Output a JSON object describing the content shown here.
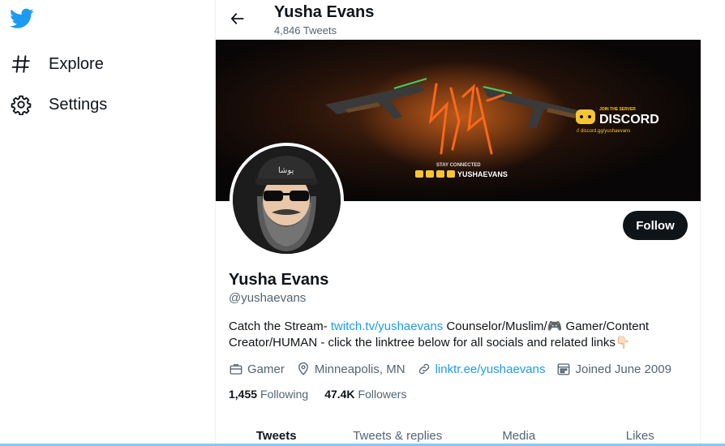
{
  "nav": {
    "items": [
      {
        "label": "Explore",
        "icon": "hashtag-icon"
      },
      {
        "label": "Settings",
        "icon": "gear-icon"
      }
    ]
  },
  "header": {
    "title": "Yusha Evans",
    "tweet_count": "4,846 Tweets"
  },
  "banner": {
    "artwork_text": "YUSHA",
    "discord_join": "JOIN THE SERVER",
    "discord_name": "DISCORD",
    "discord_url": "// discord.gg/yushaevans",
    "stay_connected": "STAY CONNECTED",
    "social_handle": "YUSHAEVANS"
  },
  "profile": {
    "name": "Yusha Evans",
    "handle": "@yushaevans",
    "follow_label": "Follow",
    "bio": {
      "prefix": "Catch the Stream- ",
      "link": "twitch.tv/yushaevans",
      "middle": " Counselor/Muslim/",
      "emoji1": "🎮",
      "suffix": " Gamer/Content Creator/HUMAN - click the linktree below for all socials and related links",
      "emoji2": "👇🏻"
    },
    "category": "Gamer",
    "location": "Minneapolis, MN",
    "website": "linktr.ee/yushaevans",
    "joined": "Joined June 2009",
    "following_count": "1,455",
    "following_label": "Following",
    "followers_count": "47.4K",
    "followers_label": "Followers"
  },
  "tabs": [
    "Tweets",
    "Tweets & replies",
    "Media",
    "Likes"
  ],
  "colors": {
    "accent": "#1d9bf0",
    "text": "#0f1419",
    "muted": "#536471",
    "banner_orange": "#ff6a1a",
    "banner_green": "#39d26b"
  }
}
